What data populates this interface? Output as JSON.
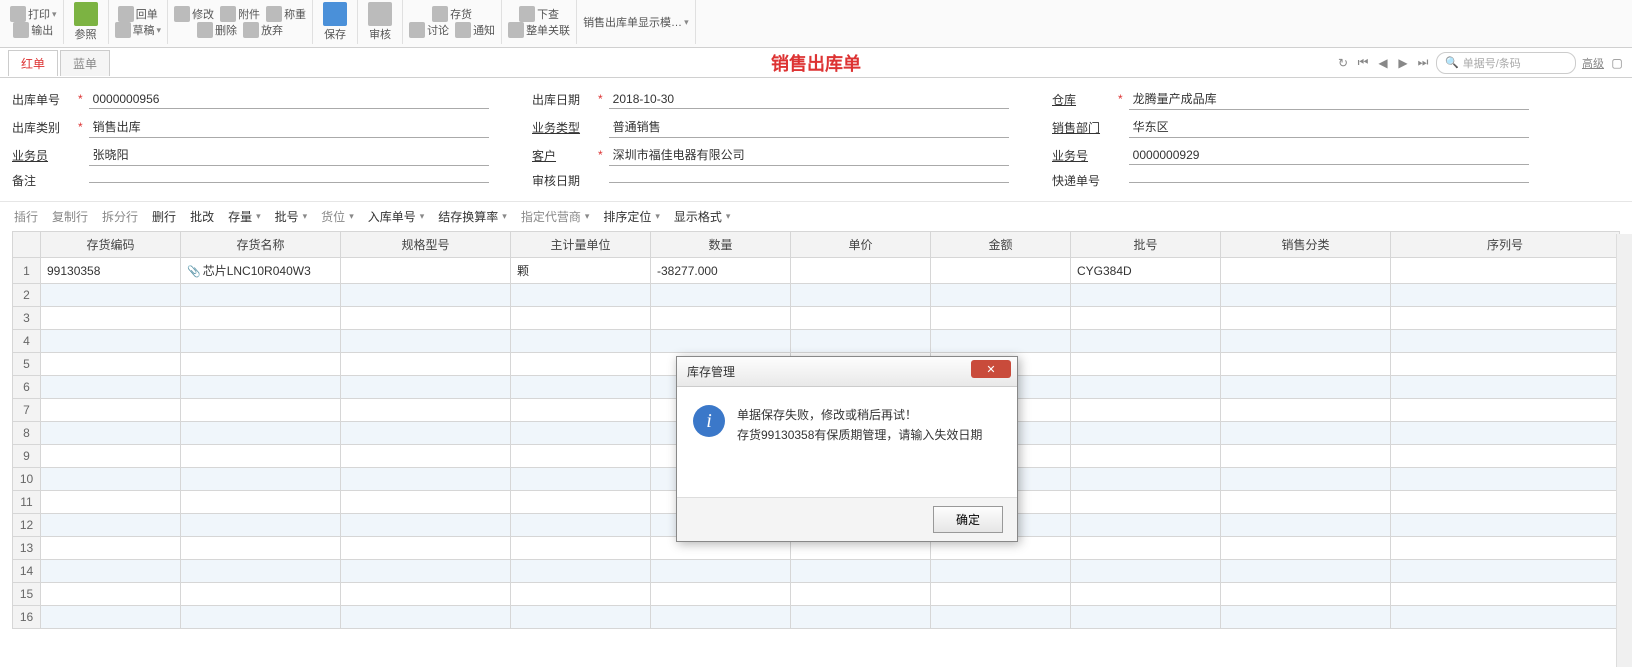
{
  "ribbon": {
    "print": "打印",
    "canzhao": "参照",
    "export": "输出",
    "xiugai": "修改",
    "fujian": "附件",
    "chengzhong": "称重",
    "huidan": "回单",
    "caogao": "草稿",
    "shanchu": "删除",
    "fangqi": "放弃",
    "baocun": "保存",
    "shenhe": "审核",
    "cunhuo": "存货",
    "taolun": "讨论",
    "tongzhi": "通知",
    "xiacha": "下查",
    "zhengdan": "整单关联",
    "template": "销售出库单显示模…"
  },
  "tabs": {
    "red": "红单",
    "blue": "蓝单"
  },
  "title": "销售出库单",
  "nav": {
    "search_placeholder": "单据号/条码",
    "advanced": "高级"
  },
  "form": {
    "out_no_label": "出库单号",
    "out_no": "0000000956",
    "out_date_label": "出库日期",
    "out_date": "2018-10-30",
    "warehouse_label": "仓库",
    "warehouse": "龙腾量产成品库",
    "out_type_label": "出库类别",
    "out_type": "销售出库",
    "biz_type_label": "业务类型",
    "biz_type": "普通销售",
    "dept_label": "销售部门",
    "dept": "华东区",
    "person_label": "业务员",
    "person": "张晓阳",
    "customer_label": "客户",
    "customer": "深圳市福佳电器有限公司",
    "biz_no_label": "业务号",
    "biz_no": "0000000929",
    "remark_label": "备注",
    "remark": "",
    "audit_date_label": "审核日期",
    "audit_date": "",
    "express_label": "快递单号",
    "express": ""
  },
  "grid_toolbar": {
    "insert": "插行",
    "copy": "复制行",
    "split": "拆分行",
    "delete": "删行",
    "batch_mod": "批改",
    "stock": "存量",
    "lot": "批号",
    "loc": "货位",
    "in_no": "入库单号",
    "conv": "结存换算率",
    "agent": "指定代营商",
    "sort": "排序定位",
    "display": "显示格式"
  },
  "columns": {
    "code": "存货编码",
    "name": "存货名称",
    "spec": "规格型号",
    "unit": "主计量单位",
    "qty": "数量",
    "price": "单价",
    "amount": "金额",
    "lot": "批号",
    "cat": "销售分类",
    "serial": "序列号"
  },
  "rows": [
    {
      "code": "99130358",
      "name": "芯片LNC10R040W3",
      "spec": "",
      "unit": "颗",
      "qty": "-38277.000",
      "price": "",
      "amount": "",
      "lot": "CYG384D",
      "cat": "",
      "serial": ""
    }
  ],
  "dialog": {
    "title": "库存管理",
    "line1": "单据保存失败，修改或稍后再试！",
    "line2": "存货99130358有保质期管理，请输入失效日期",
    "ok": "确定"
  }
}
